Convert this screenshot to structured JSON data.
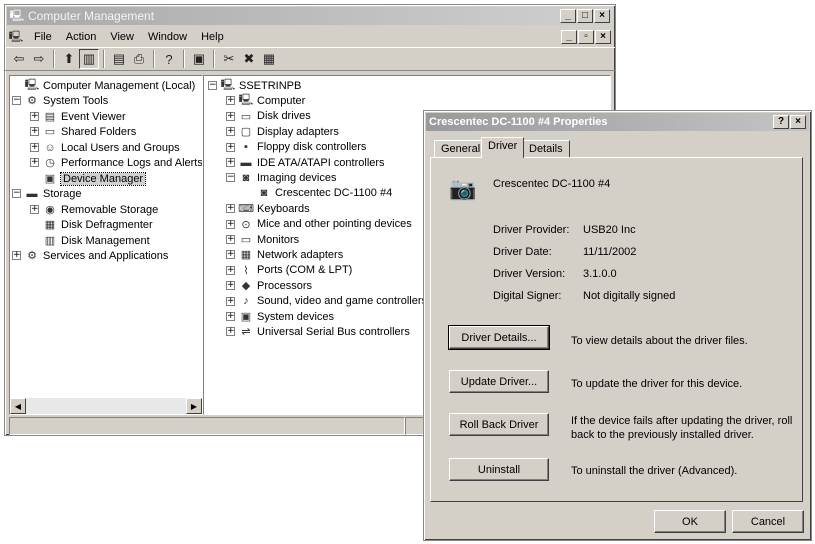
{
  "main_window": {
    "title": "Computer Management",
    "menu": [
      "File",
      "Action",
      "View",
      "Window",
      "Help"
    ],
    "tree": [
      {
        "label": "Computer Management (Local)",
        "icon": "computer-icon",
        "expander": ""
      },
      {
        "label": "System Tools",
        "icon": "tools-icon",
        "expander": "−"
      },
      {
        "label": "Event Viewer",
        "icon": "event-viewer-icon",
        "expander": "+"
      },
      {
        "label": "Shared Folders",
        "icon": "folder-icon",
        "expander": "+"
      },
      {
        "label": "Local Users and Groups",
        "icon": "users-icon",
        "expander": "+"
      },
      {
        "label": "Performance Logs and Alerts",
        "icon": "performance-icon",
        "expander": "+"
      },
      {
        "label": "Device Manager",
        "icon": "device-manager-icon",
        "expander": ""
      },
      {
        "label": "Storage",
        "icon": "storage-icon",
        "expander": "−"
      },
      {
        "label": "Removable Storage",
        "icon": "removable-storage-icon",
        "expander": "+"
      },
      {
        "label": "Disk Defragmenter",
        "icon": "defrag-icon",
        "expander": ""
      },
      {
        "label": "Disk Management",
        "icon": "disk-management-icon",
        "expander": ""
      },
      {
        "label": "Services and Applications",
        "icon": "services-icon",
        "expander": "+"
      }
    ],
    "devices": [
      {
        "label": "SSETRINPB",
        "icon": "computer-icon",
        "expander": "−"
      },
      {
        "label": "Computer",
        "icon": "computer-icon",
        "expander": "+"
      },
      {
        "label": "Disk drives",
        "icon": "disk-icon",
        "expander": "+"
      },
      {
        "label": "Display adapters",
        "icon": "display-icon",
        "expander": "+"
      },
      {
        "label": "Floppy disk controllers",
        "icon": "floppy-icon",
        "expander": "+"
      },
      {
        "label": "IDE ATA/ATAPI controllers",
        "icon": "ide-icon",
        "expander": "+"
      },
      {
        "label": "Imaging devices",
        "icon": "camera-icon",
        "expander": "−"
      },
      {
        "label": "Crescentec DC-1100 #4",
        "icon": "camera-icon",
        "expander": ""
      },
      {
        "label": "Keyboards",
        "icon": "keyboard-icon",
        "expander": "+"
      },
      {
        "label": "Mice and other pointing devices",
        "icon": "mouse-icon",
        "expander": "+"
      },
      {
        "label": "Monitors",
        "icon": "monitor-icon",
        "expander": "+"
      },
      {
        "label": "Network adapters",
        "icon": "network-icon",
        "expander": "+"
      },
      {
        "label": "Ports (COM & LPT)",
        "icon": "port-icon",
        "expander": "+"
      },
      {
        "label": "Processors",
        "icon": "processor-icon",
        "expander": "+"
      },
      {
        "label": "Sound, video and game controllers",
        "icon": "sound-icon",
        "expander": "+"
      },
      {
        "label": "System devices",
        "icon": "system-icon",
        "expander": "+"
      },
      {
        "label": "Universal Serial Bus controllers",
        "icon": "usb-icon",
        "expander": "+"
      }
    ]
  },
  "dialog": {
    "title": "Crescentec DC-1100 #4 Properties",
    "title_buttons": {
      "help": "?",
      "close": "×"
    },
    "tabs": [
      "General",
      "Driver",
      "Details"
    ],
    "device_name": "Crescentec DC-1100 #4",
    "provider_label": "Driver Provider:",
    "provider_value": "USB20 Inc",
    "date_label": "Driver Date:",
    "date_value": "11/11/2002",
    "version_label": "Driver Version:",
    "version_value": "3.1.0.0",
    "signer_label": "Digital Signer:",
    "signer_value": "Not digitally signed",
    "driver_details_button": "Driver Details...",
    "driver_details_desc": "To view details about the driver files.",
    "update_driver_button": "Update Driver...",
    "update_driver_desc": "To update the driver for this device.",
    "roll_back_button": "Roll Back Driver",
    "roll_back_desc_1": "If the device fails after updating the driver, roll",
    "roll_back_desc_2": "back to the previously installed driver.",
    "uninstall_button": "Uninstall",
    "uninstall_desc": "To uninstall the driver (Advanced).",
    "ok_button": "OK",
    "cancel_button": "Cancel"
  }
}
